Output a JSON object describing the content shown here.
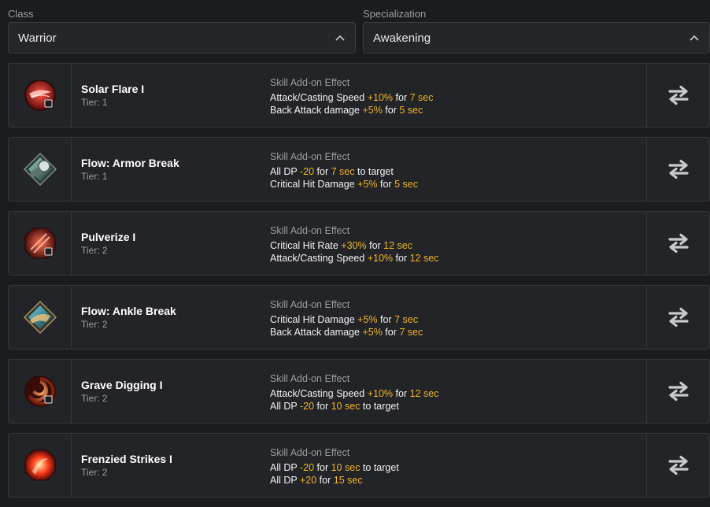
{
  "filters": {
    "class_label": "Class",
    "class_value": "Warrior",
    "spec_label": "Specialization",
    "spec_value": "Awakening"
  },
  "effect_title": "Skill Add-on Effect",
  "colors": {
    "highlight": "#f0b429",
    "background": "#1b1c1f",
    "card": "#232428"
  },
  "skills": [
    {
      "name": "Solar Flare I",
      "tier": "Tier: 1",
      "icon": "solar-flare-icon",
      "effects": [
        [
          {
            "t": "Attack/Casting Speed "
          },
          {
            "t": "+10%",
            "h": true
          },
          {
            "t": " for "
          },
          {
            "t": "7 sec",
            "h": true
          }
        ],
        [
          {
            "t": "Back Attack damage "
          },
          {
            "t": "+5%",
            "h": true
          },
          {
            "t": " for "
          },
          {
            "t": "5 sec",
            "h": true
          }
        ]
      ]
    },
    {
      "name": "Flow: Armor Break",
      "tier": "Tier: 1",
      "icon": "armor-break-icon",
      "effects": [
        [
          {
            "t": "All DP "
          },
          {
            "t": "-20",
            "h": true
          },
          {
            "t": " for "
          },
          {
            "t": "7 sec",
            "h": true
          },
          {
            "t": " to target"
          }
        ],
        [
          {
            "t": "Critical Hit Damage "
          },
          {
            "t": "+5%",
            "h": true
          },
          {
            "t": " for "
          },
          {
            "t": "5 sec",
            "h": true
          }
        ]
      ]
    },
    {
      "name": "Pulverize I",
      "tier": "Tier: 2",
      "icon": "pulverize-icon",
      "effects": [
        [
          {
            "t": "Critical Hit Rate "
          },
          {
            "t": "+30%",
            "h": true
          },
          {
            "t": " for "
          },
          {
            "t": "12 sec",
            "h": true
          }
        ],
        [
          {
            "t": "Attack/Casting Speed "
          },
          {
            "t": "+10%",
            "h": true
          },
          {
            "t": " for "
          },
          {
            "t": "12 sec",
            "h": true
          }
        ]
      ]
    },
    {
      "name": "Flow: Ankle Break",
      "tier": "Tier: 2",
      "icon": "ankle-break-icon",
      "effects": [
        [
          {
            "t": "Critical Hit Damage "
          },
          {
            "t": "+5%",
            "h": true
          },
          {
            "t": " for "
          },
          {
            "t": "7 sec",
            "h": true
          }
        ],
        [
          {
            "t": "Back Attack damage "
          },
          {
            "t": "+5%",
            "h": true
          },
          {
            "t": " for "
          },
          {
            "t": "7 sec",
            "h": true
          }
        ]
      ]
    },
    {
      "name": "Grave Digging I",
      "tier": "Tier: 2",
      "icon": "grave-digging-icon",
      "effects": [
        [
          {
            "t": "Attack/Casting Speed "
          },
          {
            "t": "+10%",
            "h": true
          },
          {
            "t": " for "
          },
          {
            "t": "12 sec",
            "h": true
          }
        ],
        [
          {
            "t": "All DP "
          },
          {
            "t": "-20",
            "h": true
          },
          {
            "t": " for "
          },
          {
            "t": "10 sec",
            "h": true
          },
          {
            "t": " to target"
          }
        ]
      ]
    },
    {
      "name": "Frenzied Strikes I",
      "tier": "Tier: 2",
      "icon": "frenzied-strikes-icon",
      "effects": [
        [
          {
            "t": "All DP "
          },
          {
            "t": "-20",
            "h": true
          },
          {
            "t": " for "
          },
          {
            "t": "10 sec",
            "h": true
          },
          {
            "t": " to target"
          }
        ],
        [
          {
            "t": "All DP "
          },
          {
            "t": "+20",
            "h": true
          },
          {
            "t": " for "
          },
          {
            "t": "15 sec",
            "h": true
          }
        ]
      ]
    }
  ]
}
